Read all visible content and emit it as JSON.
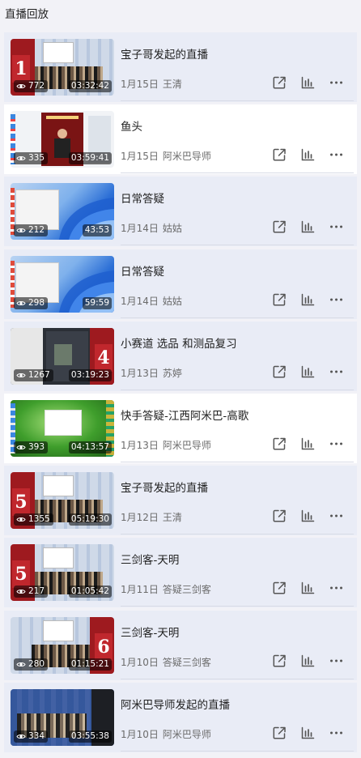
{
  "header": {
    "title": "直播回放"
  },
  "items": [
    {
      "title": "宝子哥发起的直播",
      "date": "1月15日",
      "author": "王清",
      "views": "772",
      "duration": "03:32:42",
      "bg": "blue",
      "thumb": "desktop-red",
      "badge": "1",
      "badge_side": "left"
    },
    {
      "title": "鱼头",
      "date": "1月15日",
      "author": "阿米巴导师",
      "views": "335",
      "duration": "03:59:41",
      "bg": "white",
      "thumb": "poster"
    },
    {
      "title": "日常答疑",
      "date": "1月14日",
      "author": "姑姑",
      "views": "212",
      "duration": "43:53",
      "bg": "blue",
      "thumb": "win11"
    },
    {
      "title": "日常答疑",
      "date": "1月14日",
      "author": "姑姑",
      "views": "298",
      "duration": "59:59",
      "bg": "blue",
      "thumb": "win11"
    },
    {
      "title": "小赛道 选品 和测品复习",
      "date": "1月13日",
      "author": "苏婷",
      "views": "1267",
      "duration": "03:19:23",
      "bg": "blue",
      "thumb": "dark-red",
      "badge": "4",
      "badge_side": "right"
    },
    {
      "title": "快手答疑-江西阿米巴-高歌",
      "date": "1月13日",
      "author": "阿米巴导师",
      "views": "393",
      "duration": "04:13:57",
      "bg": "white",
      "thumb": "green"
    },
    {
      "title": "宝子哥发起的直播",
      "date": "1月12日",
      "author": "王清",
      "views": "1355",
      "duration": "05:19:30",
      "bg": "blue",
      "thumb": "desktop-red",
      "badge": "5",
      "badge_side": "left"
    },
    {
      "title": "三剑客-天明",
      "date": "1月11日",
      "author": "答疑三剑客",
      "views": "217",
      "duration": "01:05:42",
      "bg": "blue",
      "thumb": "desktop-red",
      "badge": "5",
      "badge_side": "left"
    },
    {
      "title": "三剑客-天明",
      "date": "1月10日",
      "author": "答疑三剑客",
      "views": "280",
      "duration": "01:15:21",
      "bg": "blue",
      "thumb": "desktop-red",
      "badge": "6",
      "badge_side": "right"
    },
    {
      "title": "阿米巴导师发起的直播",
      "date": "1月10日",
      "author": "阿米巴导师",
      "views": "334",
      "duration": "03:55:38",
      "bg": "blue",
      "thumb": "desktop-plain"
    }
  ],
  "icons": {
    "views": "eye-icon",
    "share": "external-link-icon",
    "stats": "bar-chart-icon",
    "more": "more-dots-icon"
  },
  "colors": {
    "item_bg": "#e9ecf6",
    "item_bg_selected": "#ffffff",
    "badge_red": "#c0272d"
  }
}
